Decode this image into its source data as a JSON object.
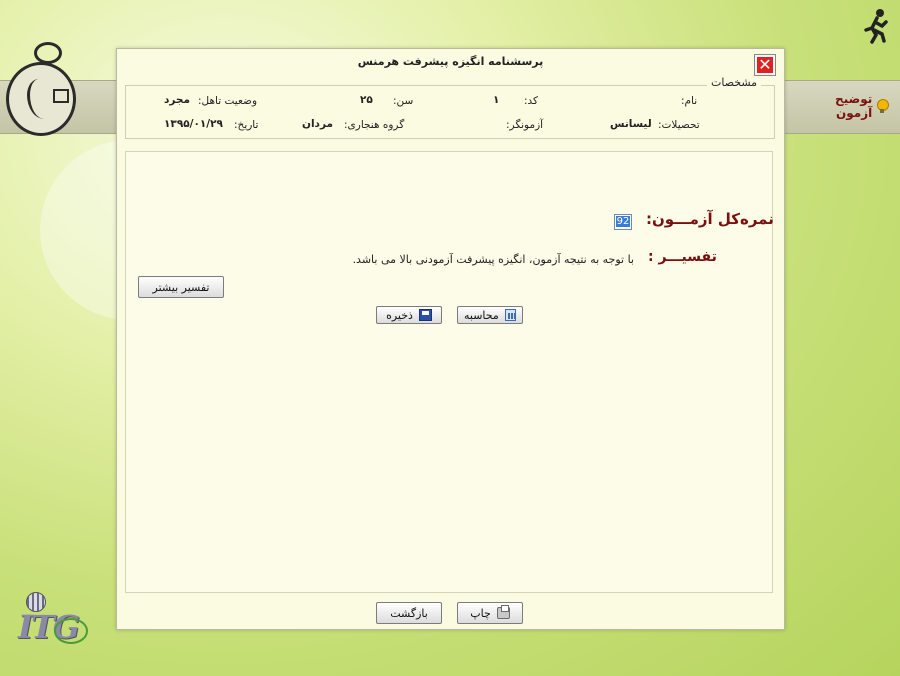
{
  "background": {
    "accent": "#c9e07a"
  },
  "banner": {
    "explain_label": "توضیح آزمون"
  },
  "dialog": {
    "title": "پرسشنامه انگیزه پیشرفت هرمنس",
    "close_icon": "close-icon",
    "info": {
      "legend": "مشخصات",
      "name_label": "نام:",
      "name_value": "",
      "code_label": "کد:",
      "code_value": "۱",
      "age_label": "سن:",
      "age_value": "۲۵",
      "marital_label": "وضعیت تاهل:",
      "marital_value": "مجرد",
      "education_label": "تحصیلات:",
      "education_value": "لیسانس",
      "examiner_label": "آزمونگر:",
      "examiner_value": "",
      "norm_group_label": "گروه هنجاری:",
      "norm_group_value": "مردان",
      "date_label": "تاریخ:",
      "date_value": "۱۳۹۵/۰۱/۲۹"
    },
    "result": {
      "score_label": "نمره‌کل آزمـــون:",
      "score_value": "92",
      "interpretation_label": "تفسیـــر :",
      "interpretation_text": "با توجه به نتیجه آزمون، انگیزه پیشرفت آزمودنی بالا می باشد."
    },
    "buttons": {
      "more_interpretation": "تفسیر بیشتر",
      "calculate": "محاسبه",
      "save": "ذخیره",
      "print": "چاپ",
      "back": "بازگشت"
    }
  },
  "colors": {
    "close_red": "#dd2222",
    "label_maroon": "#7a0f0f",
    "dialog_bg": "#fbfbe2"
  }
}
